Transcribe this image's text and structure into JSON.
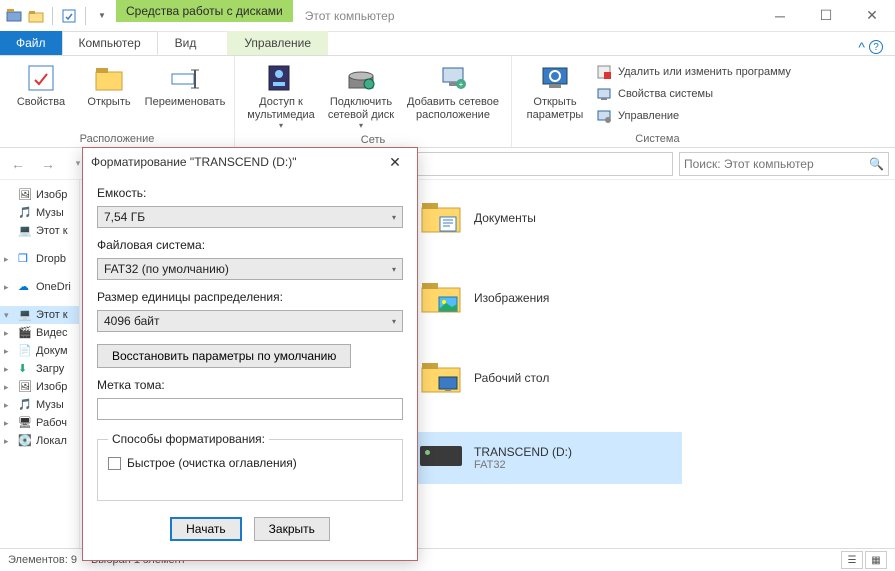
{
  "window": {
    "context_tab": "Средства работы с дисками",
    "title": "Этот компьютер",
    "context_subtab": "Управление"
  },
  "tabs": {
    "file": "Файл",
    "computer": "Компьютер",
    "view": "Вид"
  },
  "ribbon": {
    "group_location": "Расположение",
    "group_network": "Сеть",
    "group_system": "Система",
    "properties": "Свойства",
    "open": "Открыть",
    "rename": "Переименовать",
    "media_access": "Доступ к мультимедиа",
    "map_drive": "Подключить сетевой диск",
    "add_netloc": "Добавить сетевое расположение",
    "open_settings": "Открыть параметры",
    "uninstall": "Удалить или изменить программу",
    "sysprops": "Свойства системы",
    "manage": "Управление"
  },
  "nav": {
    "search_placeholder": "Поиск: Этот компьютер",
    "items": [
      "Изобр",
      "Музы",
      "Этот к",
      "Dropb",
      "OneDri",
      "Этот к",
      "Видес",
      "Докум",
      "Загру",
      "Изобр",
      "Музы",
      "Рабоч",
      "Локал"
    ]
  },
  "content": {
    "folders": [
      {
        "name": "Документы",
        "sub": ""
      },
      {
        "name": "Изображения",
        "sub": ""
      },
      {
        "name": "Рабочий стол",
        "sub": ""
      }
    ],
    "drive": {
      "name": "TRANSCEND (D:)",
      "sub": "FAT32"
    }
  },
  "status": {
    "count": "Элементов: 9",
    "selected": "Выбран 1 элемент"
  },
  "dialog": {
    "title": "Форматирование \"TRANSCEND (D:)\"",
    "capacity_label": "Емкость:",
    "capacity_value": "7,54 ГБ",
    "fs_label": "Файловая система:",
    "fs_value": "FAT32 (по умолчанию)",
    "alloc_label": "Размер единицы распределения:",
    "alloc_value": "4096 байт",
    "restore_defaults": "Восстановить параметры по умолчанию",
    "volume_label": "Метка тома:",
    "volume_value": "",
    "options_legend": "Способы форматирования:",
    "quick_format": "Быстрое (очистка оглавления)",
    "start": "Начать",
    "close": "Закрыть"
  }
}
